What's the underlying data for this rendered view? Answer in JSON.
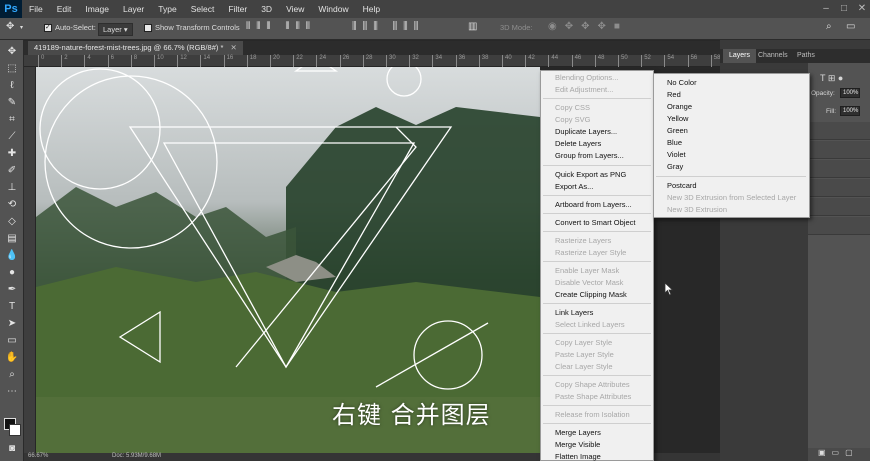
{
  "menubar": {
    "logo": "Ps",
    "items": [
      "File",
      "Edit",
      "Image",
      "Layer",
      "Type",
      "Select",
      "Filter",
      "3D",
      "View",
      "Window",
      "Help"
    ]
  },
  "options_bar": {
    "auto_select_label": "Auto-Select:",
    "auto_select_value": "Layer",
    "transform_label": "Show Transform Controls",
    "mode_label": "3D Mode:"
  },
  "document": {
    "tab_title": "419189-nature-forest-mist-trees.jpg @ 66.7% (RGB/8#) *",
    "caption": "右键 合并图层"
  },
  "rulers": {
    "top_labels": [
      "0",
      "2",
      "4",
      "6",
      "8",
      "10",
      "12",
      "14",
      "16",
      "18",
      "20",
      "22",
      "24",
      "26",
      "28",
      "30",
      "32",
      "34",
      "36",
      "38",
      "40",
      "42",
      "44",
      "46",
      "48",
      "50",
      "52",
      "54",
      "56",
      "58"
    ]
  },
  "status": {
    "zoom": "66.67%",
    "doc_size": "Doc: 5.93M/9.68M"
  },
  "panels": {
    "tabs": [
      "Layers",
      "Channels",
      "Paths"
    ],
    "opacity_label": "Opacity:",
    "opacity_value": "100%",
    "fill_label": "Fill:",
    "fill_value": "100%"
  },
  "context_menu": {
    "items": [
      {
        "label": "Blending Options...",
        "enabled": false
      },
      {
        "label": "Edit Adjustment...",
        "enabled": false
      },
      {
        "label": "Copy CSS",
        "enabled": false
      },
      {
        "label": "Copy SVG",
        "enabled": false
      },
      {
        "label": "Duplicate Layers...",
        "enabled": true
      },
      {
        "label": "Delete Layers",
        "enabled": true
      },
      {
        "label": "Group from Layers...",
        "enabled": true
      },
      {
        "label": "Quick Export as PNG",
        "enabled": true
      },
      {
        "label": "Export As...",
        "enabled": true
      },
      {
        "label": "Artboard from Layers...",
        "enabled": true
      },
      {
        "label": "Convert to Smart Object",
        "enabled": true
      },
      {
        "label": "Rasterize Layers",
        "enabled": false
      },
      {
        "label": "Rasterize Layer Style",
        "enabled": false
      },
      {
        "label": "Enable Layer Mask",
        "enabled": false
      },
      {
        "label": "Disable Vector Mask",
        "enabled": false
      },
      {
        "label": "Create Clipping Mask",
        "enabled": true
      },
      {
        "label": "Link Layers",
        "enabled": true
      },
      {
        "label": "Select Linked Layers",
        "enabled": false
      },
      {
        "label": "Copy Layer Style",
        "enabled": false
      },
      {
        "label": "Paste Layer Style",
        "enabled": false
      },
      {
        "label": "Clear Layer Style",
        "enabled": false
      },
      {
        "label": "Copy Shape Attributes",
        "enabled": false
      },
      {
        "label": "Paste Shape Attributes",
        "enabled": false
      },
      {
        "label": "Release from Isolation",
        "enabled": false
      },
      {
        "label": "Merge Layers",
        "enabled": true
      },
      {
        "label": "Merge Visible",
        "enabled": true
      },
      {
        "label": "Flatten Image",
        "enabled": true
      }
    ]
  },
  "color_submenu": {
    "items": [
      {
        "label": "No Color",
        "enabled": true
      },
      {
        "label": "Red",
        "enabled": true
      },
      {
        "label": "Orange",
        "enabled": true
      },
      {
        "label": "Yellow",
        "enabled": true
      },
      {
        "label": "Green",
        "enabled": true
      },
      {
        "label": "Blue",
        "enabled": true
      },
      {
        "label": "Violet",
        "enabled": true
      },
      {
        "label": "Gray",
        "enabled": true
      },
      {
        "label": "Postcard",
        "enabled": true
      },
      {
        "label": "New 3D Extrusion from Selected Layer",
        "enabled": false
      },
      {
        "label": "New 3D Extrusion",
        "enabled": false
      }
    ]
  },
  "colors": {
    "ui_dark": "#282828",
    "panel": "#535353",
    "menu_bg": "#f0f0f0",
    "ps_blue": "#31a8ff"
  }
}
